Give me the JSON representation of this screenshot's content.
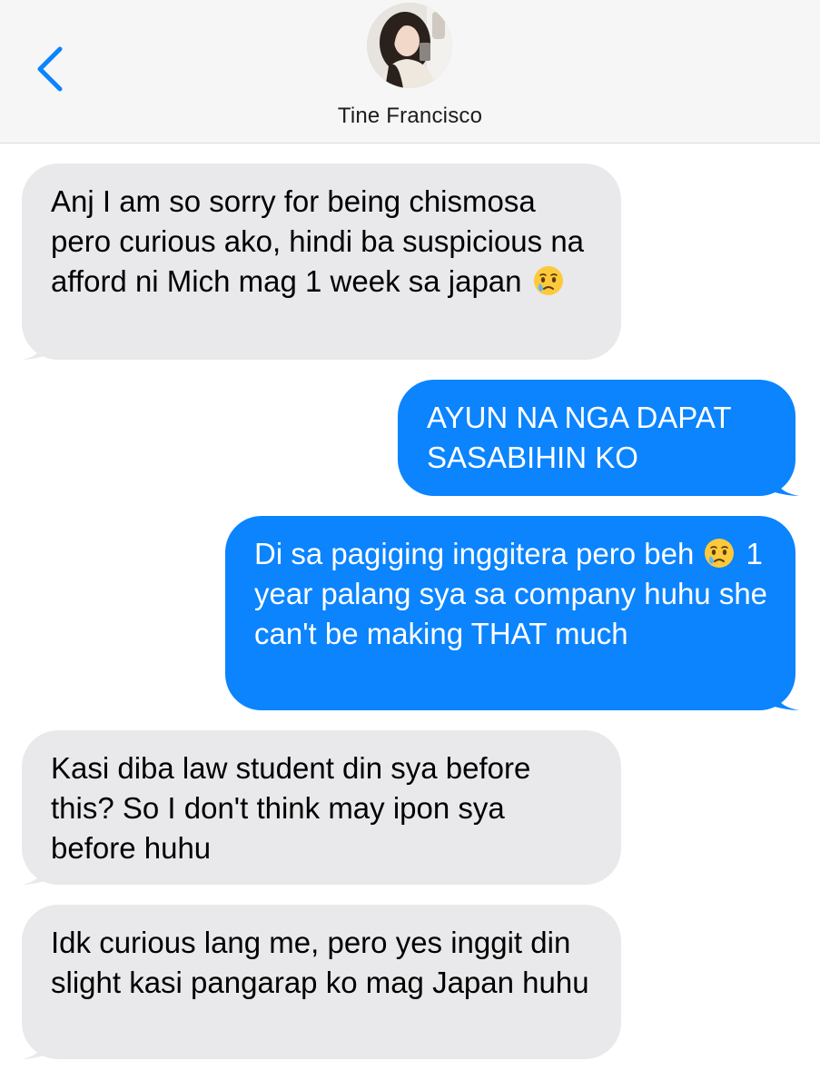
{
  "header": {
    "contact_name": "Tine Francisco",
    "avatar_alt": "Tine Francisco"
  },
  "colors": {
    "incoming_bubble": "#e9e9eb",
    "outgoing_bubble": "#0b84fe",
    "accent": "#0b84fe",
    "header_bg": "#f6f6f6"
  },
  "messages": [
    {
      "direction": "incoming",
      "text_before_emoji": "Anj I am so sorry for being chismosa pero curious ako, hindi ba suspicious na afford ni Mich mag 1 week sa japan",
      "emoji": "face-holding-back-tears-icon"
    },
    {
      "direction": "outgoing",
      "text": "AYUN NA NGA DAPAT SASABIHIN KO"
    },
    {
      "direction": "outgoing",
      "text_before_emoji": "Di sa pagiging inggitera pero beh",
      "emoji": "face-holding-back-tears-icon",
      "text_after_emoji": "1 year palang sya sa company huhu she can't be making THAT much"
    },
    {
      "direction": "incoming",
      "text": "Kasi diba law student din sya before this? So I don't think may ipon sya before huhu"
    },
    {
      "direction": "incoming",
      "text": "Idk curious lang me, pero yes inggit din slight kasi pangarap ko mag Japan huhu"
    }
  ]
}
